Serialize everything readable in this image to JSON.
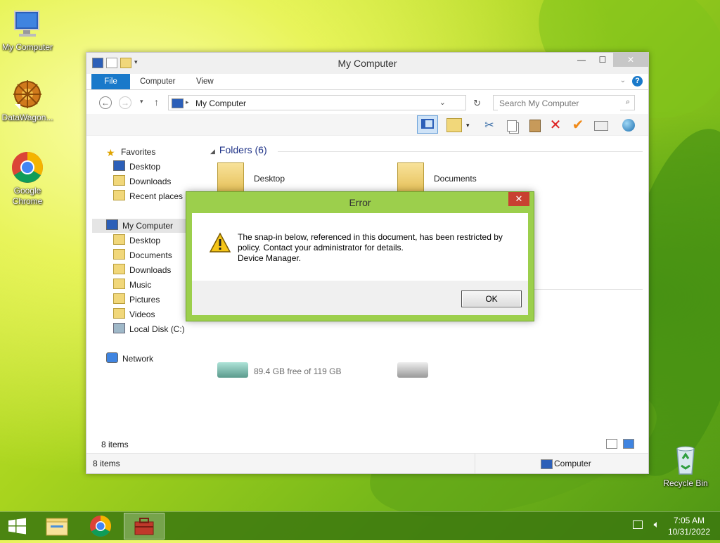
{
  "desktop": {
    "icons": [
      {
        "label": "My Computer"
      },
      {
        "label": "DataWagon..."
      },
      {
        "label": "Google Chrome"
      },
      {
        "label": "Recycle Bin"
      }
    ]
  },
  "explorer": {
    "title": "My Computer",
    "tabs": {
      "file": "File",
      "computer": "Computer",
      "view": "View"
    },
    "address": "My Computer",
    "search_placeholder": "Search My Computer",
    "nav": {
      "favorites": "Favorites",
      "fav_items": [
        "Desktop",
        "Downloads",
        "Recent places"
      ],
      "my_computer": "My Computer",
      "pc_items": [
        "Desktop",
        "Documents",
        "Downloads",
        "Music",
        "Pictures",
        "Videos",
        "Local Disk (C:)"
      ],
      "network": "Network"
    },
    "content": {
      "group_header": "Folders (6)",
      "folders": [
        "Desktop",
        "Documents"
      ],
      "disk_free": "89.4 GB free of 119 GB"
    },
    "status": {
      "items_inner": "8 items",
      "items": "8 items",
      "location": "Computer"
    }
  },
  "dialog": {
    "title": "Error",
    "close": "✕",
    "message_line1": "The snap-in below, referenced in this document, has been restricted by",
    "message_line2": "policy. Contact your administrator for details.",
    "message_line3": "Device Manager.",
    "ok_label": "OK"
  },
  "taskbar": {
    "time": "7:05 AM",
    "date": "10/31/2022"
  },
  "colors": {
    "accent": "#1979ca",
    "dialog_frame": "#9ccf4c",
    "dialog_close": "#c84031",
    "folder_header": "#1e3287"
  }
}
